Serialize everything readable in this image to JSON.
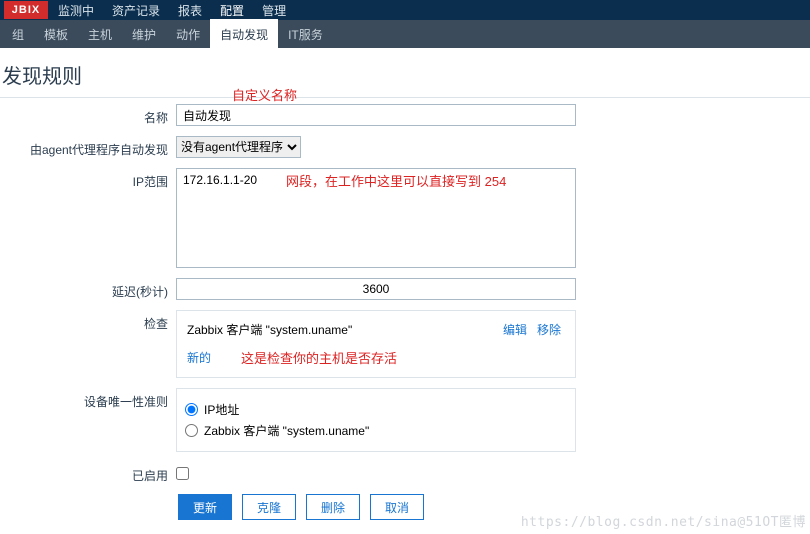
{
  "topmenu": {
    "items": [
      "监测中",
      "资产记录",
      "报表",
      "配置",
      "管理"
    ],
    "active_index": 3,
    "logo": "JBIX"
  },
  "submenu": {
    "items": [
      "组",
      "模板",
      "主机",
      "维护",
      "动作",
      "自动发现",
      "IT服务"
    ],
    "active_index": 5
  },
  "page_title": "发现规则",
  "annot": {
    "custom_name": "自定义名称",
    "ip_note": "网段，在工作中这里可以直接写到  254",
    "check_note": "这是检查你的主机是否存活"
  },
  "form": {
    "name": {
      "label": "名称",
      "value": "自动发现"
    },
    "agent": {
      "label": "由agent代理程序自动发现",
      "selected": "没有agent代理程序"
    },
    "iprange": {
      "label": "IP范围",
      "value": "172.16.1.1-20"
    },
    "delay": {
      "label": "延迟(秒计)",
      "value": "3600"
    },
    "checks": {
      "label": "检查",
      "line": "Zabbix 客户端 \"system.uname\"",
      "new": "新的",
      "edit": "编辑",
      "remove": "移除"
    },
    "unique": {
      "label": "设备唯一性准则",
      "opt1": "IP地址",
      "opt2": "Zabbix 客户端 \"system.uname\""
    },
    "enabled": {
      "label": "已启用"
    }
  },
  "buttons": {
    "update": "更新",
    "clone": "克隆",
    "delete": "删除",
    "cancel": "取消"
  },
  "watermark": "https://blog.csdn.net/sina@51OT匿博"
}
